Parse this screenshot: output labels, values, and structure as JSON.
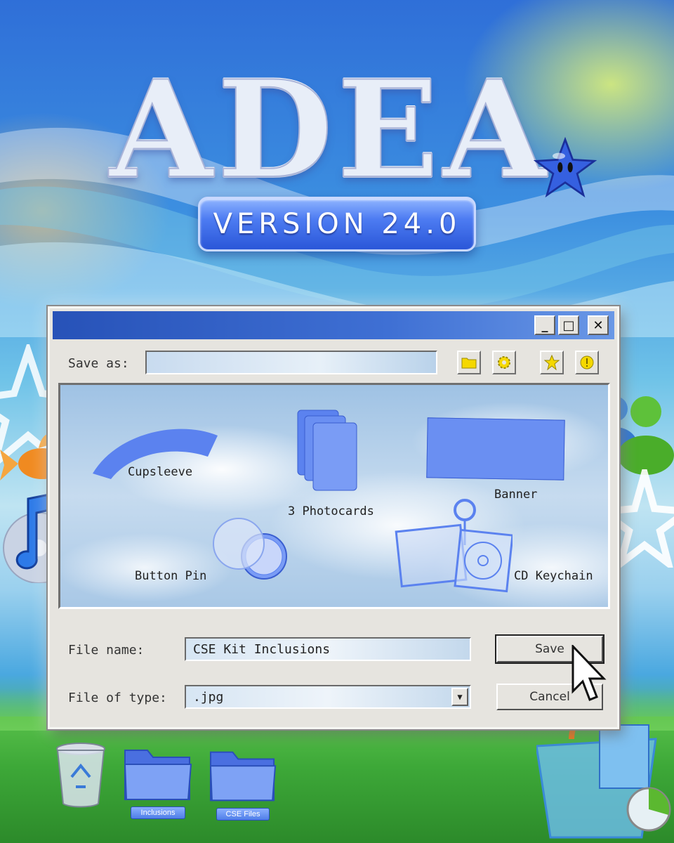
{
  "logo": {
    "title": "ADEA",
    "version": "VERSION 24.0"
  },
  "dialog": {
    "window_buttons": {
      "minimize": "_",
      "maximize": "□",
      "close": "✕"
    },
    "save_as_label": "Save as:",
    "save_as_value": "",
    "toolbar_icons": [
      "folder-icon",
      "gear-icon",
      "star-icon",
      "info-icon"
    ],
    "items": [
      {
        "name": "cupsleeve",
        "label": "Cupsleeve"
      },
      {
        "name": "photocards",
        "label": "3 Photocards"
      },
      {
        "name": "banner",
        "label": "Banner"
      },
      {
        "name": "button-pin",
        "label": "Button Pin"
      },
      {
        "name": "cd-keychain",
        "label": "CD Keychain"
      }
    ],
    "file_name_label": "File name:",
    "file_name_value": "CSE Kit Inclusions",
    "file_type_label": "File of type:",
    "file_type_value": ".jpg",
    "save_label": "Save",
    "cancel_label": "Cancel"
  },
  "desktop": {
    "folders": [
      {
        "label": "Inclusions"
      },
      {
        "label": "CSE Files"
      }
    ],
    "icons": [
      "recycle-bin-icon",
      "music-cd-icon",
      "goldfish-icon",
      "messenger-icon",
      "shopping-bag-icon",
      "mouse-cursor-icon"
    ]
  },
  "colors": {
    "item_blue": "#5b82ef",
    "titlebar": "#2752b8",
    "dialog_bg": "#e6e4df"
  }
}
